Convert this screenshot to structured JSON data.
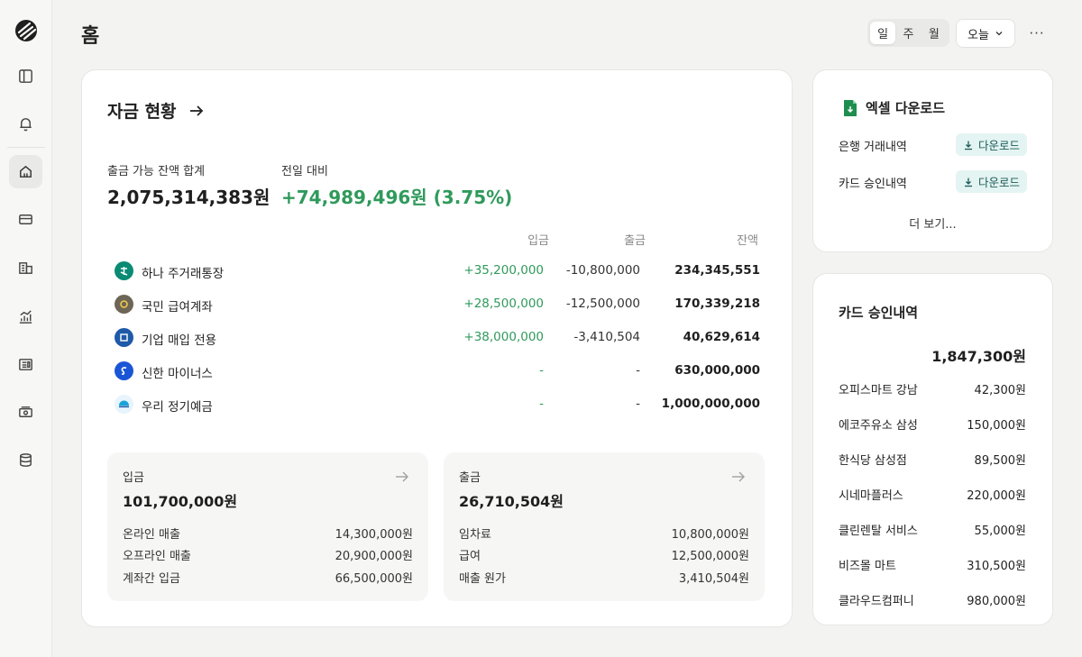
{
  "header": {
    "title": "홈",
    "period_tabs": [
      "일",
      "주",
      "월"
    ],
    "active_tab": "일",
    "date_select": "오늘",
    "more": "···"
  },
  "sidebar": {
    "items": [
      "panel-icon",
      "bell-icon",
      "home-icon",
      "card-icon",
      "building-icon",
      "chart-icon",
      "news-icon",
      "cash-icon",
      "database-icon"
    ],
    "active": "home-icon"
  },
  "funds": {
    "title": "자금 현황",
    "available_label": "출금 가능 잔액 합계",
    "available_value": "2,075,314,383원",
    "change_label": "전일 대비",
    "change_value": "+74,989,496원 (3.75%)",
    "columns": [
      "입금",
      "출금",
      "잔액"
    ],
    "accounts": [
      {
        "name": "하나 주거래통장",
        "in": "+35,200,000",
        "out": "-10,800,000",
        "balance": "234,345,551",
        "color": "#0b8a74"
      },
      {
        "name": "국민 급여계좌",
        "in": "+28,500,000",
        "out": "-12,500,000",
        "balance": "170,339,218",
        "color": "#6d6656"
      },
      {
        "name": "기업 매입 전용",
        "in": "+38,000,000",
        "out": "-3,410,504",
        "balance": "40,629,614",
        "color": "#1f5aa8"
      },
      {
        "name": "신한 마이너스",
        "in": "-",
        "out": "-",
        "balance": "630,000,000",
        "color": "#1a55d6"
      },
      {
        "name": "우리 정기예금",
        "in": "-",
        "out": "-",
        "balance": "1,000,000,000",
        "color": "#1aa3d9"
      }
    ],
    "inflow": {
      "label": "입금",
      "total": "101,700,000원",
      "lines": [
        {
          "name": "온라인 매출",
          "amount": "14,300,000원"
        },
        {
          "name": "오프라인 매출",
          "amount": "20,900,000원"
        },
        {
          "name": "계좌간 입금",
          "amount": "66,500,000원"
        }
      ]
    },
    "outflow": {
      "label": "출금",
      "total": "26,710,504원",
      "lines": [
        {
          "name": "임차료",
          "amount": "10,800,000원"
        },
        {
          "name": "급여",
          "amount": "12,500,000원"
        },
        {
          "name": "매출 원가",
          "amount": "3,410,504원"
        }
      ]
    }
  },
  "excel": {
    "title": "엑셀 다운로드",
    "rows": [
      {
        "name": "은행 거래내역",
        "button": "다운로드"
      },
      {
        "name": "카드 승인내역",
        "button": "다운로드"
      }
    ],
    "more": "더 보기..."
  },
  "card_approvals": {
    "title": "카드 승인내역",
    "total": "1,847,300원",
    "items": [
      {
        "name": "오피스마트 강남",
        "amount": "42,300원"
      },
      {
        "name": "에코주유소 삼성",
        "amount": "150,000원"
      },
      {
        "name": "한식당 삼성점",
        "amount": "89,500원"
      },
      {
        "name": "시네마플러스",
        "amount": "220,000원"
      },
      {
        "name": "클린렌탈 서비스",
        "amount": "55,000원"
      },
      {
        "name": "비즈몰 마트",
        "amount": "310,500원"
      },
      {
        "name": "클라우드컴퍼니",
        "amount": "980,000원"
      }
    ]
  },
  "colors": {
    "positive": "#2f9a5b",
    "download_bg": "#e4f4f2",
    "excel_green": "#1e8e4e"
  }
}
